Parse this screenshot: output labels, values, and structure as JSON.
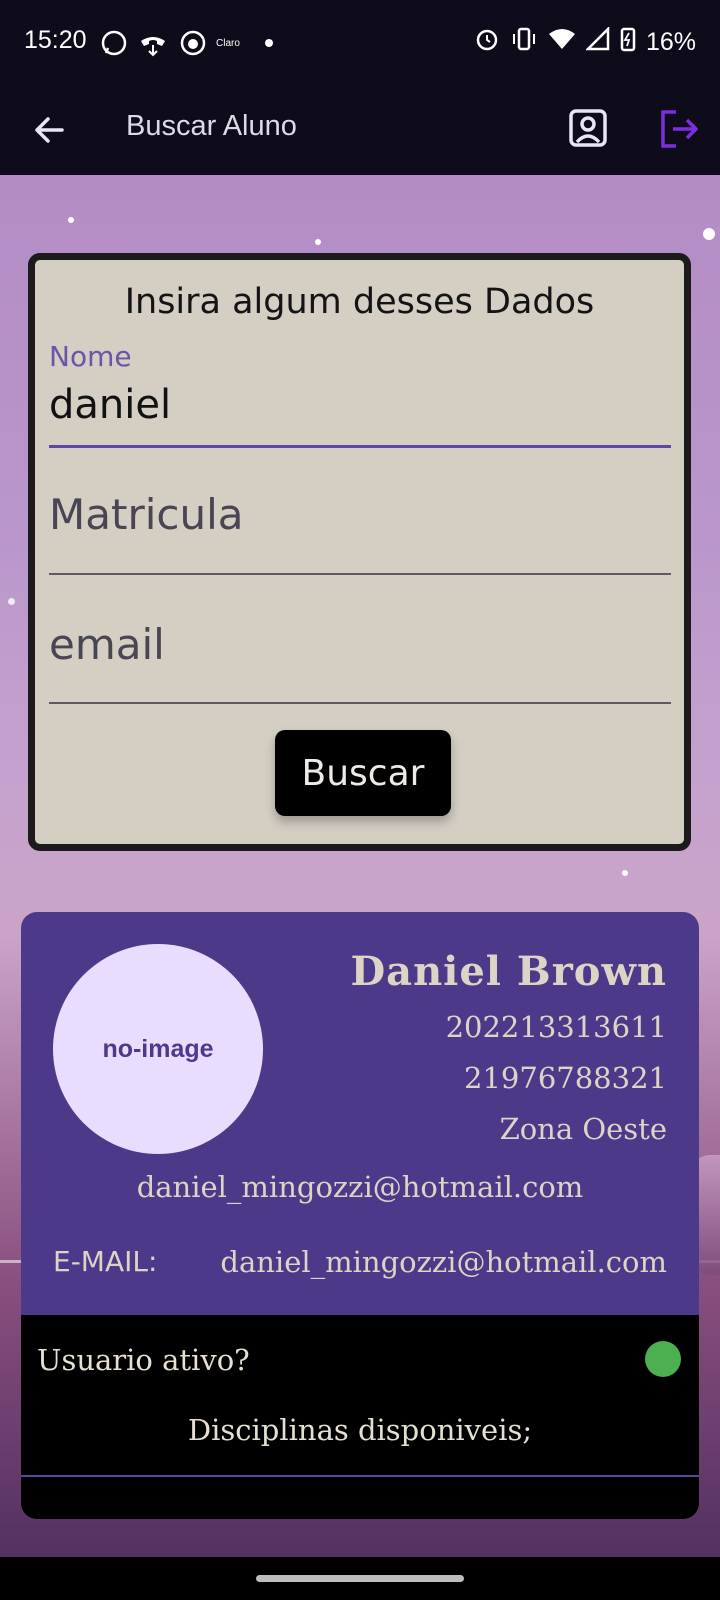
{
  "status_bar": {
    "time": "15:20",
    "carrier": "Claro",
    "battery": "16%",
    "left_icons": [
      "whatsapp-icon",
      "call-icon",
      "cat-icon",
      "claro-icon",
      "dot-icon"
    ],
    "right_icons": [
      "alarm-icon",
      "vibrate-icon",
      "wifi-icon",
      "signal-icon",
      "battery-icon"
    ]
  },
  "app_bar": {
    "title": "Buscar Aluno",
    "accent": "#7b2fe0"
  },
  "search_form": {
    "heading": "Insira algum desses Dados",
    "nome_label": "Nome",
    "nome_value": "daniel",
    "matricula_placeholder": "Matricula",
    "email_placeholder": "email",
    "button_label": "Buscar"
  },
  "result": {
    "avatar_text": "no-image",
    "name": "Daniel  Brown",
    "matricula": "202213313611",
    "phone": "21976788321",
    "region": "Zona Oeste",
    "email": "daniel_mingozzi@hotmail.com",
    "email_label": "E-MAIL:",
    "email_value": "daniel_mingozzi@hotmail.com",
    "active_label": "Usuario ativo?",
    "active_color": "#4caf50",
    "disciplines_label": "Disciplinas disponiveis;"
  }
}
